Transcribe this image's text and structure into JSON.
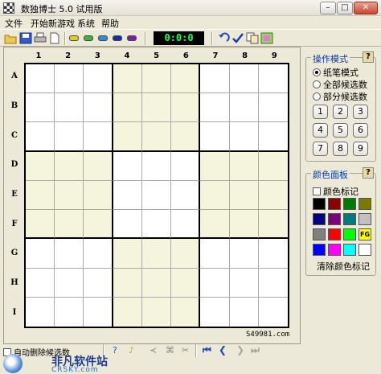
{
  "window": {
    "title": "数独博士 5.0 试用版",
    "min": "–",
    "max": "□",
    "close": "✕"
  },
  "menu": [
    "文件",
    "开始新游戏",
    "系统",
    "帮助"
  ],
  "toolbar": {
    "timer": "0:0:0",
    "pill_colors": [
      "#e0d020",
      "#3cb43c",
      "#2b8fd6",
      "#1a2bb0",
      "#7a1fa8"
    ]
  },
  "board": {
    "col_labels": [
      "1",
      "2",
      "3",
      "4",
      "5",
      "6",
      "7",
      "8",
      "9"
    ],
    "row_labels": [
      "A",
      "B",
      "C",
      "D",
      "E",
      "F",
      "G",
      "H",
      "I"
    ],
    "site": "S49981.com",
    "shade_color": "#f5f4dc"
  },
  "mode_panel": {
    "title": "操作模式",
    "help": "?",
    "options": [
      {
        "label": "纸笔模式",
        "selected": true
      },
      {
        "label": "全部候选数",
        "selected": false
      },
      {
        "label": "部分候选数",
        "selected": false
      }
    ],
    "numbers": [
      "1",
      "2",
      "3",
      "4",
      "5",
      "6",
      "7",
      "8",
      "9"
    ]
  },
  "color_panel": {
    "title": "颜色面板",
    "help": "?",
    "checkbox_label": "颜色标记",
    "swatches": [
      {
        "color": "#000000",
        "label": ""
      },
      {
        "color": "#8b0000",
        "label": ""
      },
      {
        "color": "#007a00",
        "label": ""
      },
      {
        "color": "#7a7a00",
        "label": ""
      },
      {
        "color": "#000080",
        "label": ""
      },
      {
        "color": "#7a007a",
        "label": ""
      },
      {
        "color": "#007a7a",
        "label": ""
      },
      {
        "color": "#c0c0c0",
        "label": ""
      },
      {
        "color": "#808080",
        "label": ""
      },
      {
        "color": "#ff0000",
        "label": ""
      },
      {
        "color": "#00ff00",
        "label": ""
      },
      {
        "color": "#ffff00",
        "label": "FG"
      },
      {
        "color": "#0000ff",
        "label": ""
      },
      {
        "color": "#ff00ff",
        "label": ""
      },
      {
        "color": "#00ffff",
        "label": ""
      },
      {
        "color": "#ffffff",
        "label": ""
      }
    ],
    "clear_label": "清除颜色标记"
  },
  "status": {
    "auto_label": "自动删除候选数",
    "nav": [
      "⏮",
      "❮",
      "❯",
      "⏭"
    ]
  },
  "watermark": {
    "cn": "非凡软件站",
    "en": "CRSKY.com"
  }
}
